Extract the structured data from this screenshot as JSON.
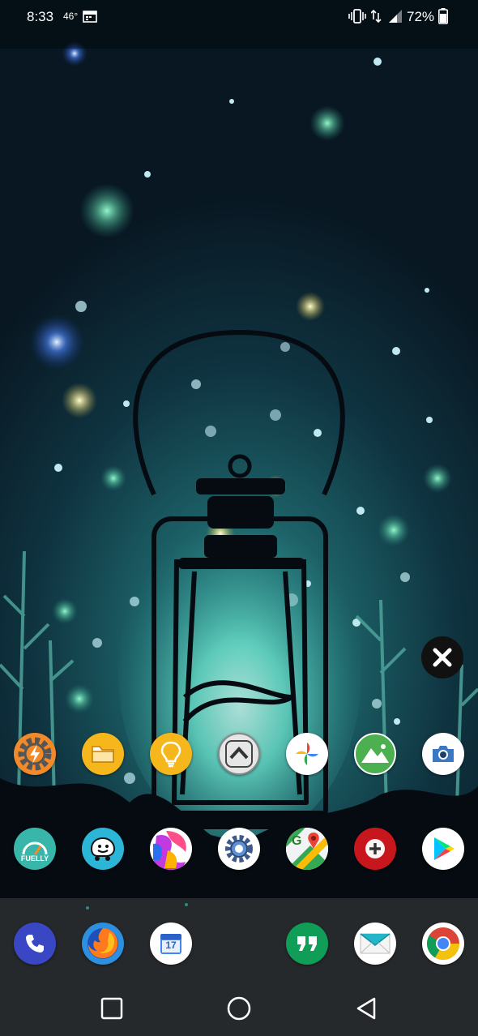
{
  "status_bar": {
    "time": "8:33",
    "temperature": "46°",
    "battery": "72%"
  },
  "home": {
    "row1": [
      {
        "name": "Tasker",
        "icon": "gear-bolt-icon",
        "color": "#f28a2a"
      },
      {
        "name": "Files",
        "icon": "folder-icon",
        "color": "#f6b71c"
      },
      {
        "name": "Ideas",
        "icon": "lightbulb-icon",
        "color": "#f6b71c"
      },
      {
        "name": "Launcher",
        "icon": "chevron-up-icon",
        "color": "#e6e6e6"
      },
      {
        "name": "Photos",
        "icon": "pinwheel-icon",
        "color": "#ffffff"
      },
      {
        "name": "Gallery",
        "icon": "mountain-icon",
        "color": "#4caf50"
      },
      {
        "name": "Camera",
        "icon": "camera-icon",
        "color": "#ffffff"
      }
    ],
    "row2": [
      {
        "name": "Fuelly",
        "icon": "fuelly-icon",
        "label": "FUELLY",
        "color": "#38b6a9"
      },
      {
        "name": "Waze",
        "icon": "waze-icon",
        "color": "#2bb5d6"
      },
      {
        "name": "Wallpapers",
        "icon": "abstract-art-icon",
        "color": "#c239e0"
      },
      {
        "name": "Settings",
        "icon": "settings-gear-icon",
        "color": "#ffffff"
      },
      {
        "name": "Maps",
        "icon": "map-pin-icon",
        "label": "G",
        "color": "#34a853"
      },
      {
        "name": "Plus",
        "icon": "plus-icon",
        "color": "#c8161d"
      },
      {
        "name": "Play Store",
        "icon": "play-store-icon",
        "color": "#ffffff"
      }
    ]
  },
  "dock": [
    {
      "name": "Phone",
      "icon": "phone-icon",
      "color": "#3947c4"
    },
    {
      "name": "Firefox",
      "icon": "firefox-icon",
      "color": "#2c8fe0"
    },
    {
      "name": "Calendar",
      "icon": "calendar-icon",
      "label": "17",
      "color": "#4285f4"
    },
    {
      "name": "Hangouts",
      "icon": "quote-icon",
      "color": "#0f9d58"
    },
    {
      "name": "Email",
      "icon": "envelope-icon",
      "color": "#ffffff"
    },
    {
      "name": "Chrome",
      "icon": "chrome-icon",
      "color": "#ffffff"
    }
  ],
  "nav": [
    "recents",
    "home",
    "back"
  ]
}
